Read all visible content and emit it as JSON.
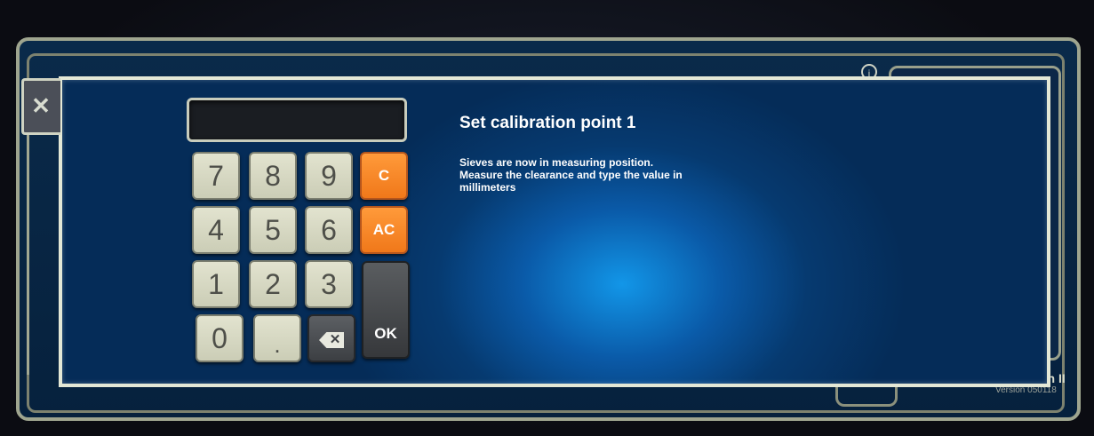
{
  "background": {
    "brand_fragment": "on II",
    "version": "Version 050118"
  },
  "dialog": {
    "title": "Set calibration point 1",
    "instructions": [
      "Sieves are now in measuring position.",
      "Measure the clearance and type the value in",
      "millimeters"
    ],
    "display_value": ""
  },
  "keypad": {
    "row1": [
      "7",
      "8",
      "9"
    ],
    "row2": [
      "4",
      "5",
      "6"
    ],
    "row3": [
      "1",
      "2",
      "3"
    ],
    "zero": "0",
    "decimal": ".",
    "clear": "C",
    "all_clear": "AC",
    "ok": "OK"
  },
  "icons": {
    "close": "close-icon",
    "info": "info-icon",
    "backspace": "backspace-icon"
  },
  "colors": {
    "accent_orange": "#f5841f",
    "dialog_blue": "#0a5aa8",
    "frame": "#e4e8d6"
  }
}
